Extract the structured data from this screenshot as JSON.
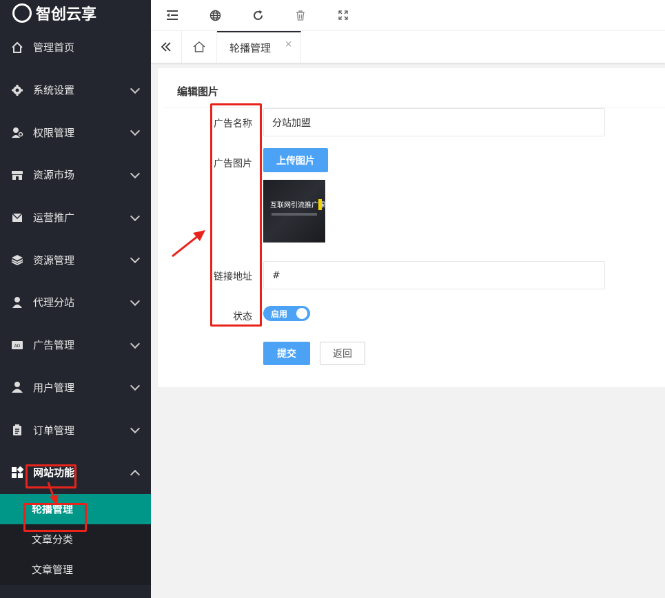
{
  "brand": {
    "name": "智创云享"
  },
  "sidebar": {
    "items": [
      {
        "label": "管理首页",
        "icon": "home-icon",
        "expandable": false
      },
      {
        "label": "系统设置",
        "icon": "gear-icon",
        "expandable": true
      },
      {
        "label": "权限管理",
        "icon": "key-user-icon",
        "expandable": true
      },
      {
        "label": "资源市场",
        "icon": "store-icon",
        "expandable": true
      },
      {
        "label": "运营推广",
        "icon": "mail-icon",
        "expandable": true
      },
      {
        "label": "资源管理",
        "icon": "layers-icon",
        "expandable": true
      },
      {
        "label": "代理分站",
        "icon": "agent-icon",
        "expandable": true
      },
      {
        "label": "广告管理",
        "icon": "ad-icon",
        "expandable": true
      },
      {
        "label": "用户管理",
        "icon": "user-icon",
        "expandable": true
      },
      {
        "label": "订单管理",
        "icon": "clipboard-icon",
        "expandable": true
      },
      {
        "label": "网站功能",
        "icon": "grid-icon",
        "expandable": true,
        "expanded": true
      }
    ],
    "subitems": [
      {
        "label": "轮播管理",
        "active": true
      },
      {
        "label": "文章分类",
        "active": false
      },
      {
        "label": "文章管理",
        "active": false
      }
    ]
  },
  "toolbar": {
    "icons": [
      "menu-collapse-icon",
      "globe-icon",
      "refresh-icon",
      "trash-icon",
      "fullscreen-icon"
    ]
  },
  "tabs": {
    "active_label": "轮播管理",
    "close": "×"
  },
  "form": {
    "title": "编辑图片",
    "name_label": "广告名称",
    "name_value": "分站加盟",
    "image_label": "广告图片",
    "upload_label": "上传图片",
    "thumb_text": "互联网引流推广课程",
    "link_label": "链接地址",
    "link_value": "#",
    "status_label": "状态",
    "status_value": "启用",
    "submit_label": "提交",
    "back_label": "返回"
  },
  "colors": {
    "sidebar_bg": "#23262e",
    "active_bg": "#009688",
    "primary": "#4ca3f5",
    "annotation": "#e8231b"
  }
}
